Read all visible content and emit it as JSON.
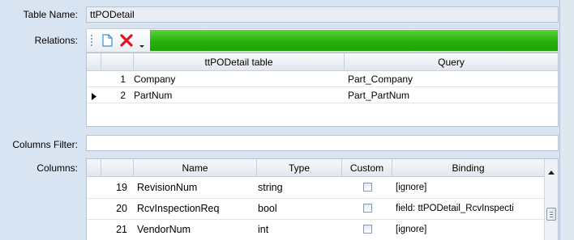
{
  "table_name": {
    "label": "Table Name:",
    "value": "ttPODetail"
  },
  "relations": {
    "label": "Relations:",
    "toolbar": {
      "new_icon": "new-document-icon",
      "delete_icon": "red-x-delete-icon",
      "dropdown_icon": "dropdown-arrow-icon",
      "bar_color": "#27b10c"
    },
    "headers": [
      "ttPODetail table",
      "Query"
    ],
    "rows": [
      {
        "num": "1",
        "field": "Company",
        "query": "Part_Company",
        "current": false
      },
      {
        "num": "2",
        "field": "PartNum",
        "query": "Part_PartNum",
        "current": true
      }
    ]
  },
  "columns_filter": {
    "label": "Columns Filter:",
    "value": ""
  },
  "columns": {
    "label": "Columns:",
    "headers": [
      "Name",
      "Type",
      "Custom",
      "Binding"
    ],
    "rows": [
      {
        "num": "19",
        "name": "RevisionNum",
        "type": "string",
        "custom": false,
        "binding": "[ignore]"
      },
      {
        "num": "20",
        "name": "RcvInspectionReq",
        "type": "bool",
        "custom": false,
        "binding": "field: ttPODetail_RcvInspecti"
      },
      {
        "num": "21",
        "name": "VendorNum",
        "type": "int",
        "custom": false,
        "binding": "[ignore]"
      }
    ]
  }
}
